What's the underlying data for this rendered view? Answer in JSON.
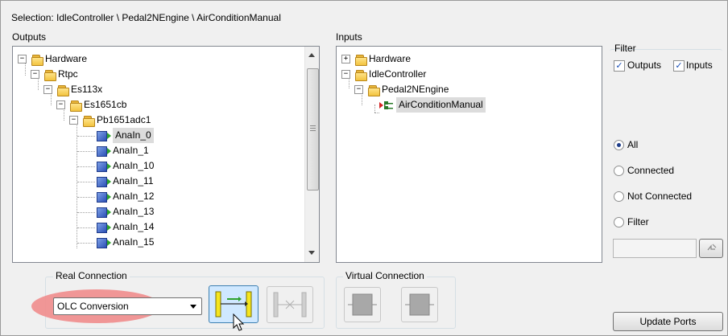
{
  "selection": {
    "label": "Selection: IdleController \\ Pedal2NEngine \\ AirConditionManual"
  },
  "outputs": {
    "title": "Outputs",
    "tree": [
      {
        "label": "Hardware",
        "icon": "folder-icon",
        "expander": "minus"
      },
      {
        "label": "Rtpc",
        "icon": "folder-icon",
        "expander": "minus"
      },
      {
        "label": "Es113x",
        "icon": "folder-icon",
        "expander": "minus"
      },
      {
        "label": "Es1651cb",
        "icon": "folder-icon",
        "expander": "minus"
      },
      {
        "label": "Pb1651adc1",
        "icon": "folder-icon",
        "expander": "minus"
      },
      {
        "label": "AnaIn_0",
        "icon": "output-port-icon",
        "selected": true
      },
      {
        "label": "AnaIn_1",
        "icon": "output-port-icon"
      },
      {
        "label": "AnaIn_10",
        "icon": "output-port-icon"
      },
      {
        "label": "AnaIn_11",
        "icon": "output-port-icon"
      },
      {
        "label": "AnaIn_12",
        "icon": "output-port-icon"
      },
      {
        "label": "AnaIn_13",
        "icon": "output-port-icon"
      },
      {
        "label": "AnaIn_14",
        "icon": "output-port-icon"
      },
      {
        "label": "AnaIn_15",
        "icon": "output-port-icon"
      }
    ]
  },
  "inputs": {
    "title": "Inputs",
    "tree": [
      {
        "label": "Hardware",
        "icon": "folder-icon",
        "expander": "plus"
      },
      {
        "label": "IdleController",
        "icon": "folder-icon",
        "expander": "minus"
      },
      {
        "label": "Pedal2NEngine",
        "icon": "folder-icon",
        "expander": "minus"
      },
      {
        "label": "AirConditionManual",
        "icon": "input-port-icon",
        "selected": true
      }
    ]
  },
  "filter": {
    "title": "Filter",
    "outputs_label": "Outputs",
    "inputs_label": "Inputs",
    "outputs_checked": true,
    "inputs_checked": true,
    "radios": [
      {
        "label": "All",
        "checked": true
      },
      {
        "label": "Connected",
        "checked": false
      },
      {
        "label": "Not Connected",
        "checked": false
      },
      {
        "label": "Filter",
        "checked": false
      }
    ],
    "filter_text": "",
    "update_ports_label": "Update Ports"
  },
  "real_connection": {
    "title": "Real Connection",
    "select_value": "OLC Conversion",
    "highlight_color": "#f08c8c"
  },
  "virtual_connection": {
    "title": "Virtual Connection"
  },
  "colors": {
    "accent": "#1f3e8a",
    "connect_button_bg": "#cfe8ff"
  }
}
